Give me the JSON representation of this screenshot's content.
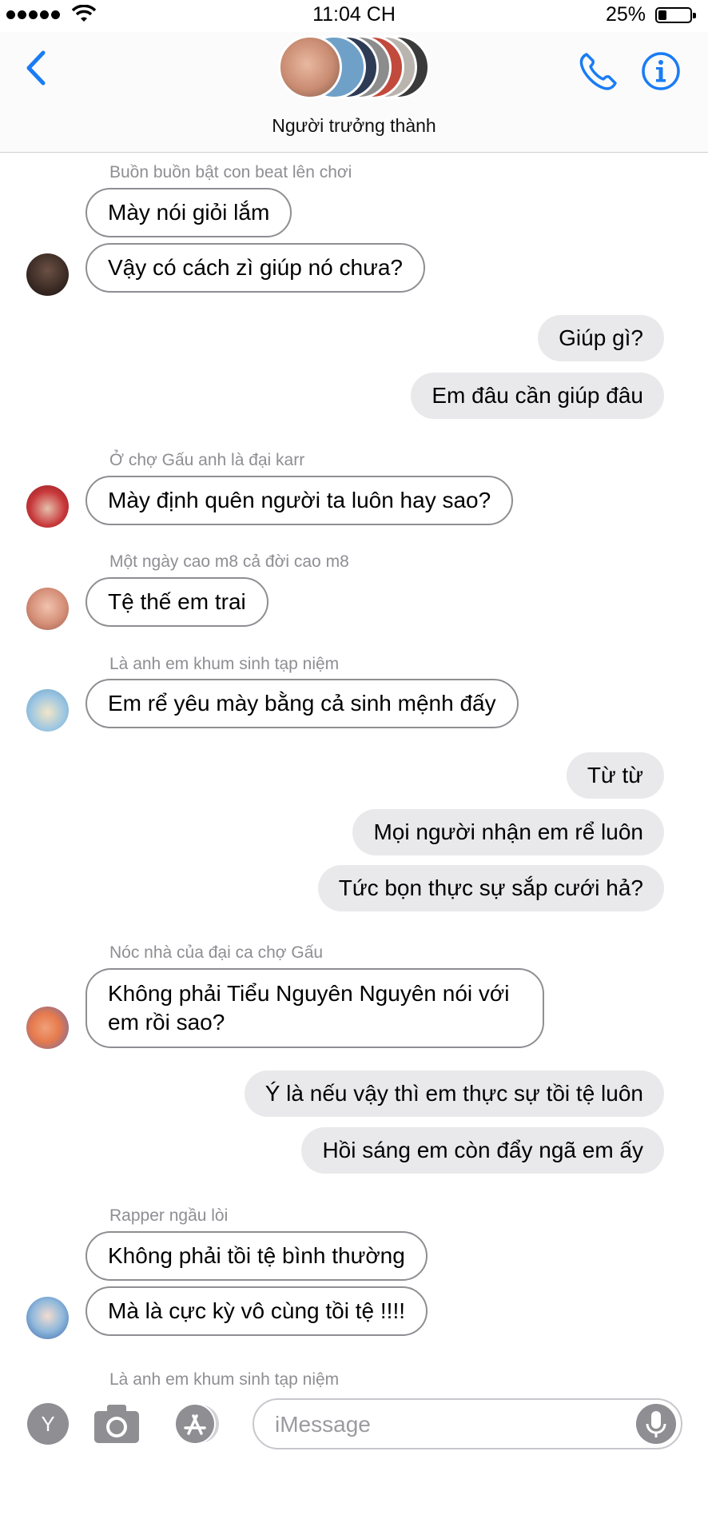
{
  "status_bar": {
    "time": "11:04 CH",
    "battery": "25%"
  },
  "header": {
    "group_name": "Người trưởng thành"
  },
  "messages": [
    {
      "sender": "Buồn buồn bật con beat lên chơi"
    },
    {
      "text": "Mày nói giỏi lắm",
      "direction": "in"
    },
    {
      "text": "Vậy có cách zì giúp nó chưa?",
      "direction": "in"
    },
    {
      "text": "Giúp gì?",
      "direction": "out"
    },
    {
      "text": "Em đâu cần giúp đâu",
      "direction": "out"
    },
    {
      "sender": "Ở chợ Gấu anh là đại karr"
    },
    {
      "text": "Mày định quên người ta luôn hay sao?",
      "direction": "in"
    },
    {
      "sender": "Một ngày cao m8 cả đời cao m8"
    },
    {
      "text": "Tệ thế em trai",
      "direction": "in"
    },
    {
      "sender": "Là anh em khum sinh tạp niệm"
    },
    {
      "text": "Em rể yêu mày bằng cả sinh mệnh đấy",
      "direction": "in"
    },
    {
      "text": "Từ từ",
      "direction": "out"
    },
    {
      "text": "Mọi người nhận em rể luôn",
      "direction": "out"
    },
    {
      "text": "Tức bọn thực sự sắp cưới hả?",
      "direction": "out"
    },
    {
      "sender": "Nóc nhà của đại ca chợ Gấu"
    },
    {
      "text": "Không phải Tiểu Nguyên Nguyên nói với em rồi sao?",
      "direction": "in"
    },
    {
      "text": "Ý là nếu vậy thì em thực sự tồi tệ luôn",
      "direction": "out"
    },
    {
      "text": "Hồi sáng em còn đẩy ngã em ấy",
      "direction": "out"
    },
    {
      "sender": "Rapper ngầu lòi"
    },
    {
      "text": "Không phải tồi tệ bình thường",
      "direction": "in"
    },
    {
      "text": "Mà là cực kỳ vô cùng tồi tệ !!!!",
      "direction": "in"
    },
    {
      "sender": "Là anh em khum sinh tạp niệm"
    }
  ],
  "input_bar": {
    "y_button": "Y",
    "placeholder": "iMessage"
  },
  "colors": {
    "accent": "#1a7cf5",
    "outgoing_bubble": "#e9e9eb",
    "incoming_border": "#8e8e93",
    "sender_text": "#8e8e93"
  },
  "icons": [
    "back-chevron-icon",
    "phone-icon",
    "info-icon",
    "camera-icon",
    "app-store-icon",
    "microphone-icon",
    "wifi-icon",
    "battery-icon"
  ]
}
